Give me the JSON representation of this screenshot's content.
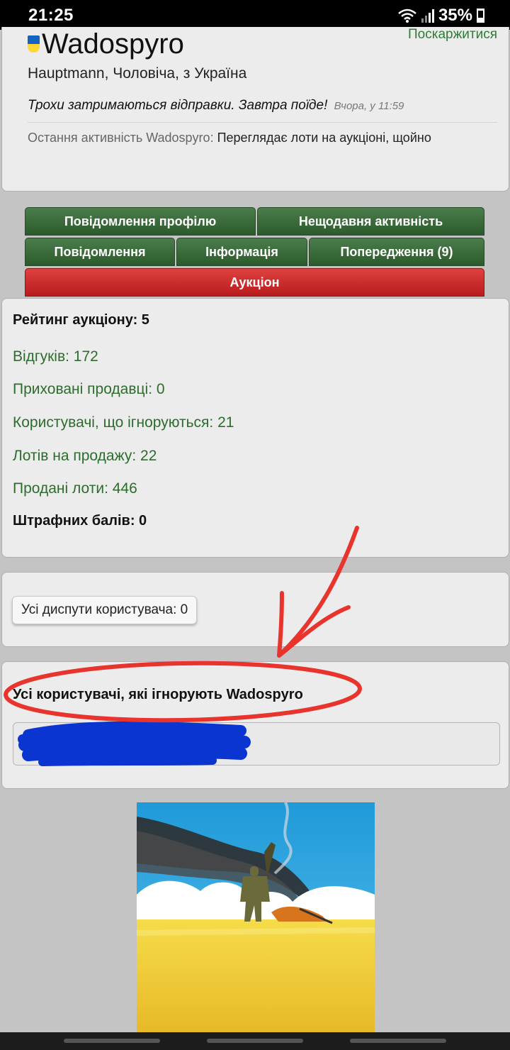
{
  "status_bar": {
    "time": "21:25",
    "battery": "35%"
  },
  "profile": {
    "report_link": "Поскаржитися",
    "username": "Wadospyro",
    "rank": "Hauptmann",
    "gender": "Чоловіча",
    "from_prefix": "з",
    "country": "Україна",
    "status_message": "Трохи затримаються відправки. Завтра поїде!",
    "status_time": "Вчора, у 11:59",
    "activity_label": "Остання активність Wadospyro:",
    "activity_value": "Переглядає лоти на аукціоні, щойно"
  },
  "tabs": {
    "profile_messages": "Повідомлення профілю",
    "recent_activity": "Нещодавня активність",
    "messages": "Повідомлення",
    "info": "Інформація",
    "warnings": "Попередження (9)",
    "auction": "Аукціон"
  },
  "auction": {
    "rating_label": "Рейтинг аукціону: 5",
    "feedbacks": "Відгуків: 172",
    "hidden_sellers": "Приховані продавці: 0",
    "ignored_users": "Користувачі, що ігноруються: 21",
    "lots_for_sale": "Лотів на продажу: 22",
    "sold_lots": "Продані лоти: 446",
    "penalty_points": "Штрафних балів: 0"
  },
  "disputes": {
    "button_label": "Усі диспути користувача: 0"
  },
  "ignoring": {
    "title": "Усі користувачі, які ігнорують Wadospyro"
  },
  "colors": {
    "tab_green": "#2c5a2c",
    "tab_red": "#b71c1c",
    "stat_green": "#2e6b2e",
    "annotation_red": "#e8342c",
    "scribble_blue": "#0a35d0"
  }
}
